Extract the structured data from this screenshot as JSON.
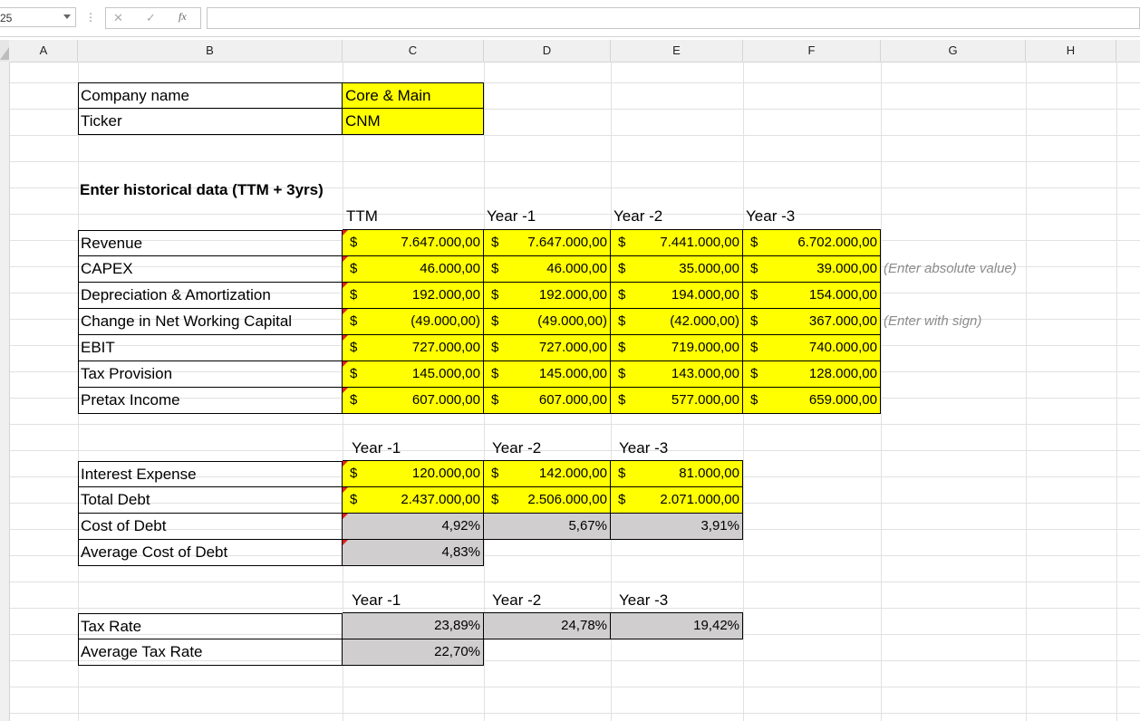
{
  "formula_bar": {
    "name_box": "25",
    "fx_label": "fx",
    "cancel": "✕",
    "enter": "✓",
    "dots": "⋮"
  },
  "columns": [
    "A",
    "B",
    "C",
    "D",
    "E",
    "F",
    "G",
    "H"
  ],
  "rows": [
    "",
    "",
    "",
    "",
    "",
    "",
    "",
    "",
    "",
    "",
    "",
    "",
    "",
    "",
    "",
    "",
    "",
    "",
    "",
    "",
    "",
    "",
    "",
    "",
    ""
  ],
  "company": {
    "name_label": "Company name",
    "name_value": "Core & Main",
    "ticker_label": "Ticker",
    "ticker_value": "CNM"
  },
  "historical": {
    "title": "Enter historical data (TTM + 3yrs)",
    "headers": [
      "TTM",
      "Year -1",
      "Year -2",
      "Year -3"
    ],
    "rows": [
      {
        "label": "Revenue",
        "values": [
          "7.647.000,00",
          "7.647.000,00",
          "7.441.000,00",
          "6.702.000,00"
        ],
        "note": ""
      },
      {
        "label": "CAPEX",
        "values": [
          "46.000,00",
          "46.000,00",
          "35.000,00",
          "39.000,00"
        ],
        "note": "(Enter absolute value)"
      },
      {
        "label": "Depreciation & Amortization",
        "values": [
          "192.000,00",
          "192.000,00",
          "194.000,00",
          "154.000,00"
        ],
        "note": ""
      },
      {
        "label": "Change in Net Working Capital",
        "values": [
          "(49.000,00)",
          "(49.000,00)",
          "(42.000,00)",
          "367.000,00"
        ],
        "note": "(Enter with sign)"
      },
      {
        "label": "EBIT",
        "values": [
          "727.000,00",
          "727.000,00",
          "719.000,00",
          "740.000,00"
        ],
        "note": ""
      },
      {
        "label": "Tax Provision",
        "values": [
          "145.000,00",
          "145.000,00",
          "143.000,00",
          "128.000,00"
        ],
        "note": ""
      },
      {
        "label": "Pretax Income",
        "values": [
          "607.000,00",
          "607.000,00",
          "577.000,00",
          "659.000,00"
        ],
        "note": ""
      }
    ],
    "currency": "$"
  },
  "debt": {
    "headers": [
      "Year -1",
      "Year -2",
      "Year -3"
    ],
    "interest_label": "Interest Expense",
    "interest_values": [
      "120.000,00",
      "142.000,00",
      "81.000,00"
    ],
    "debt_label": "Total Debt",
    "debt_values": [
      "2.437.000,00",
      "2.506.000,00",
      "2.071.000,00"
    ],
    "cost_label": "Cost of Debt",
    "cost_values": [
      "4,92%",
      "5,67%",
      "3,91%"
    ],
    "avg_label": "Average Cost of Debt",
    "avg_value": "4,83%"
  },
  "tax": {
    "headers": [
      "Year -1",
      "Year -2",
      "Year -3"
    ],
    "rate_label": "Tax Rate",
    "rate_values": [
      "23,89%",
      "24,78%",
      "19,42%"
    ],
    "avg_label": "Average Tax Rate",
    "avg_value": "22,70%"
  },
  "colors": {
    "input_fill": "#ffff00",
    "calc_fill": "#d0cece",
    "comment_marker": "#e02020",
    "note_text": "#8c8c8c"
  }
}
